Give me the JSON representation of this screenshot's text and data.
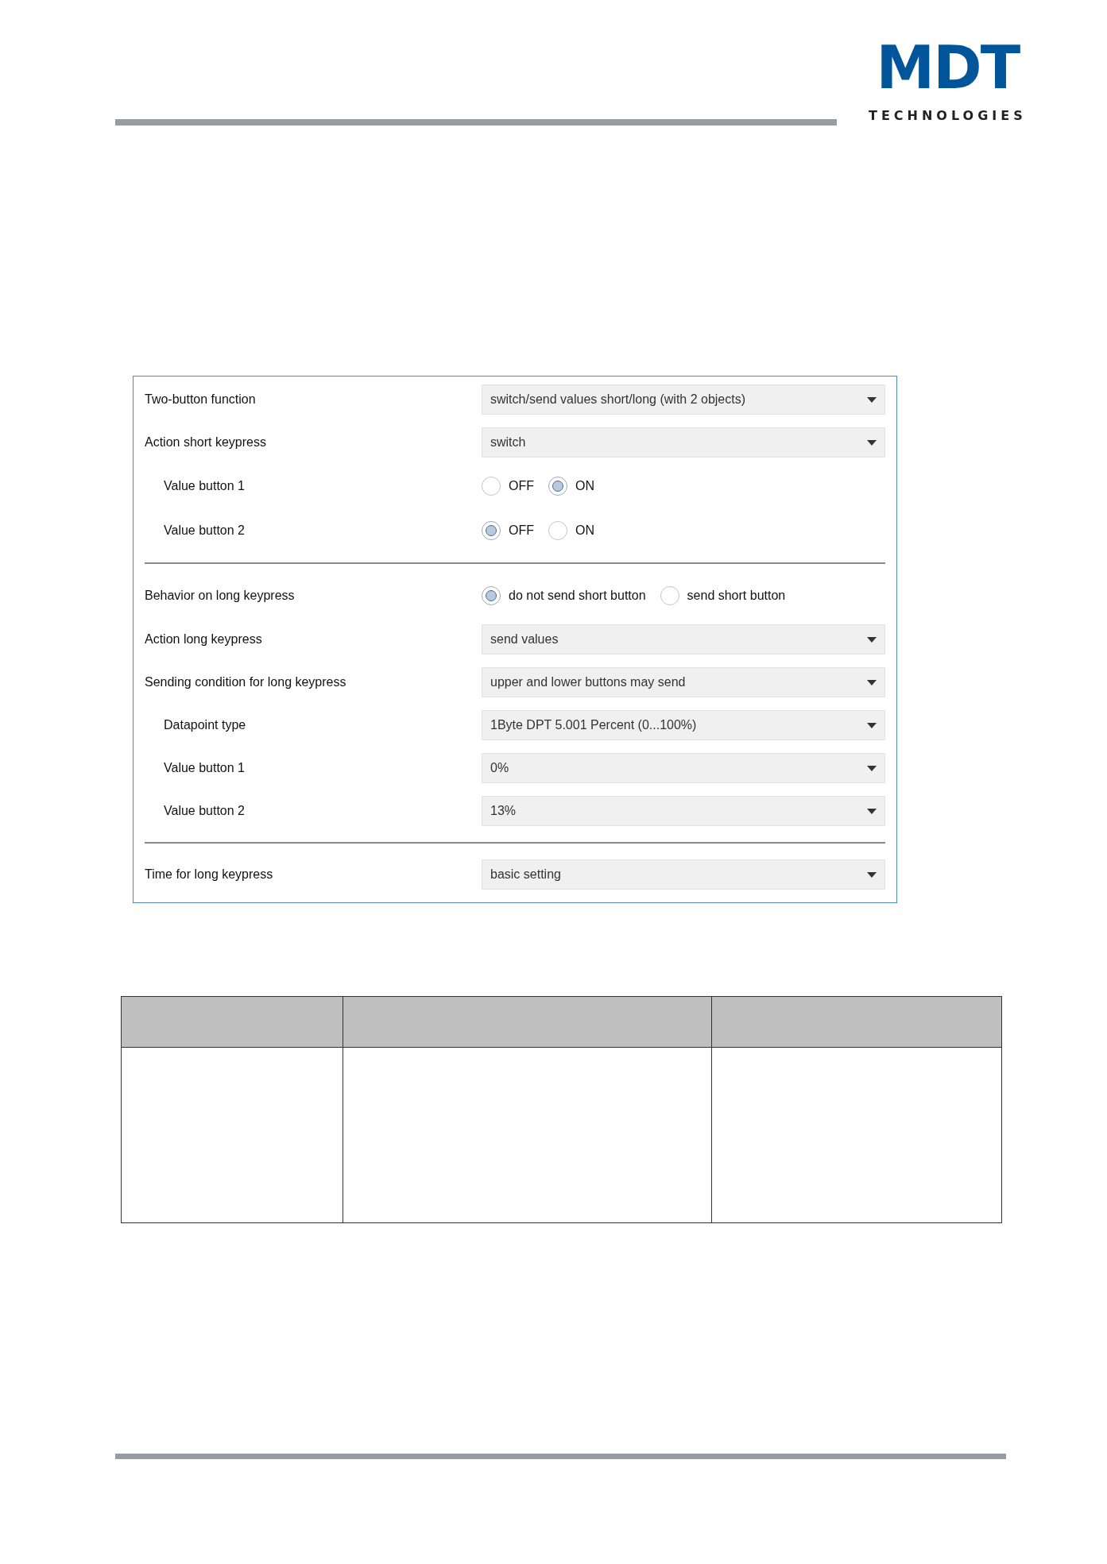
{
  "logo": {
    "mark": "MDT",
    "tagline": "TECHNOLOGIES"
  },
  "settings": [
    {
      "kind": "select",
      "label": "Two-button function",
      "indented": false,
      "value": "switch/send values short/long (with 2 objects)"
    },
    {
      "kind": "select",
      "label": "Action short keypress",
      "indented": false,
      "value": "switch"
    },
    {
      "kind": "radio",
      "label": "Value button 1",
      "indented": true,
      "options": [
        {
          "label": "OFF",
          "selected": false
        },
        {
          "label": "ON",
          "selected": true
        }
      ]
    },
    {
      "kind": "radio",
      "label": "Value button 2",
      "indented": true,
      "options": [
        {
          "label": "OFF",
          "selected": true
        },
        {
          "label": "ON",
          "selected": false
        }
      ]
    },
    {
      "kind": "divider"
    },
    {
      "kind": "radio",
      "label": "Behavior on long keypress",
      "indented": false,
      "options": [
        {
          "label": "do not send short button",
          "selected": true
        },
        {
          "label": "send short button",
          "selected": false
        }
      ]
    },
    {
      "kind": "select",
      "label": "Action long keypress",
      "indented": false,
      "value": "send values"
    },
    {
      "kind": "select",
      "label": "Sending condition for long keypress",
      "indented": false,
      "value": "upper and lower buttons may send"
    },
    {
      "kind": "select",
      "label": "Datapoint type",
      "indented": true,
      "value": "1Byte DPT 5.001 Percent (0...100%)"
    },
    {
      "kind": "select",
      "label": "Value button 1",
      "indented": true,
      "value": "0%"
    },
    {
      "kind": "select",
      "label": "Value button 2",
      "indented": true,
      "value": "13%"
    },
    {
      "kind": "divider"
    },
    {
      "kind": "select",
      "label": "Time for long keypress",
      "indented": false,
      "value": "basic setting"
    }
  ]
}
